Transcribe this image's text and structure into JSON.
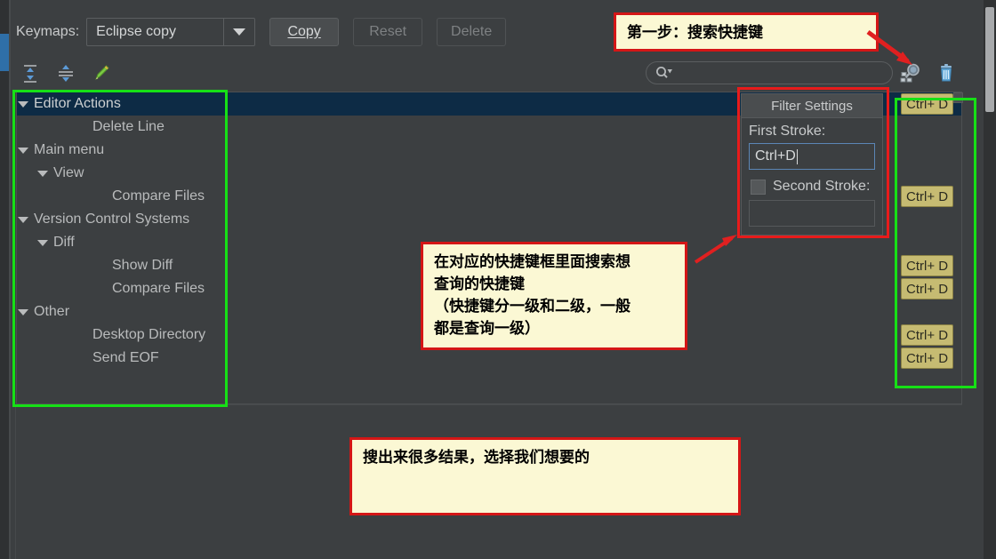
{
  "header": {
    "keymaps_label": "Keymaps:",
    "keymap_value": "Eclipse copy",
    "copy_button": "Copy",
    "reset_button": "Reset",
    "delete_button": "Delete"
  },
  "toolbar": {
    "expand_all_icon": "expand-all-icon",
    "collapse_all_icon": "collapse-all-icon",
    "edit_icon": "edit-pencil-icon"
  },
  "search": {
    "value": "",
    "placeholder": "",
    "icon": "search-icon",
    "dropdown_icon": "chevron-down-icon"
  },
  "right_icons": {
    "find_shortcut": "find-shortcut-icon",
    "delete": "trash-icon"
  },
  "tree": {
    "rows": [
      {
        "label": "Editor Actions",
        "indent": 0,
        "expander": true,
        "selected": true,
        "shortcut": "Ctrl+ D"
      },
      {
        "label": "Delete Line",
        "indent": 2,
        "expander": false,
        "selected": false,
        "shortcut": ""
      },
      {
        "label": "Main menu",
        "indent": 0,
        "expander": true,
        "selected": false,
        "shortcut": ""
      },
      {
        "label": "View",
        "indent": 1,
        "expander": true,
        "selected": false,
        "shortcut": ""
      },
      {
        "label": "Compare Files",
        "indent": 3,
        "expander": false,
        "selected": false,
        "shortcut": "Ctrl+ D"
      },
      {
        "label": "Version Control Systems",
        "indent": 0,
        "expander": true,
        "selected": false,
        "shortcut": ""
      },
      {
        "label": "Diff",
        "indent": 1,
        "expander": true,
        "selected": false,
        "shortcut": ""
      },
      {
        "label": "Show Diff",
        "indent": 3,
        "expander": false,
        "selected": false,
        "shortcut": "Ctrl+ D"
      },
      {
        "label": "Compare Files",
        "indent": 3,
        "expander": false,
        "selected": false,
        "shortcut": "Ctrl+ D"
      },
      {
        "label": "Other",
        "indent": 0,
        "expander": true,
        "selected": false,
        "shortcut": ""
      },
      {
        "label": "Desktop Directory",
        "indent": 2,
        "expander": false,
        "selected": false,
        "shortcut": "Ctrl+ D"
      },
      {
        "label": "Send EOF",
        "indent": 2,
        "expander": false,
        "selected": false,
        "shortcut": "Ctrl+ D"
      }
    ]
  },
  "filter_popup": {
    "title": "Filter Settings",
    "first_stroke_label": "First Stroke:",
    "first_stroke_value": "Ctrl+D",
    "second_stroke_label": "Second Stroke:",
    "second_stroke_value": "",
    "second_stroke_checked": false
  },
  "annotations": {
    "step1": "第一步：搜索快捷键",
    "middle_l1": "在对应的快捷键框里面搜索想",
    "middle_l2": "查询的快捷键",
    "middle_l3": "（快捷键分一级和二级，一般",
    "middle_l4": "都是查询一级）",
    "bottom": "搜出来很多结果，选择我们想要的"
  },
  "colors": {
    "background": "#3c3f41",
    "selection": "#0d2b45",
    "highlight_green": "#16e016",
    "highlight_red": "#e81b1b",
    "note_fill": "#fbf8d4",
    "badge": "#c6bb72",
    "accent_blue": "#2f6fa8"
  }
}
